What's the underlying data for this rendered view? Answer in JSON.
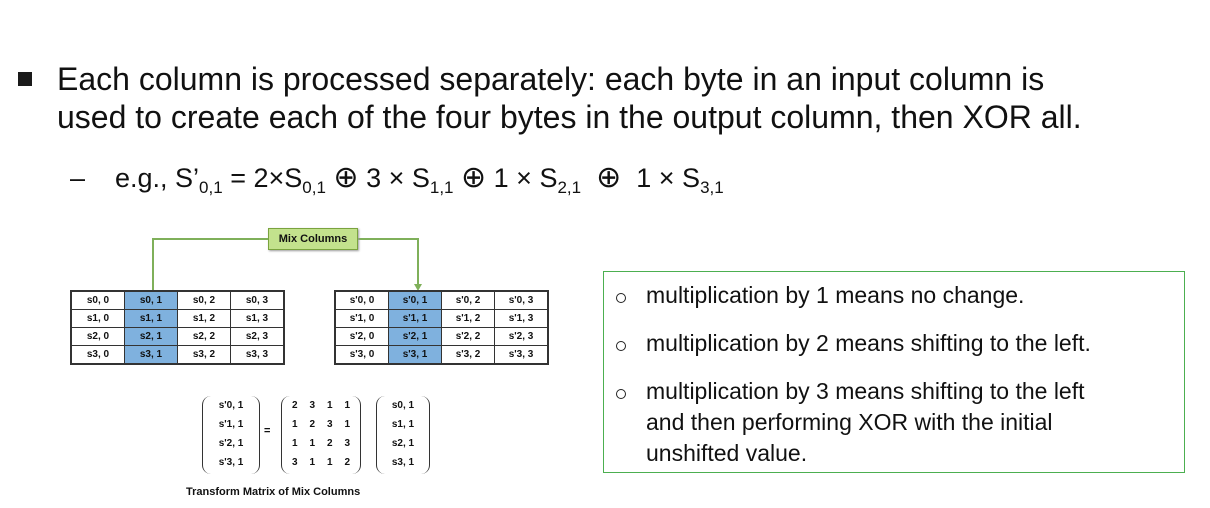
{
  "bullet_text": {
    "line1": "Each column is processed separately: each byte in an input column is",
    "line2": "used to create each of the four bytes in the output column, then XOR all."
  },
  "example": {
    "dash": "–",
    "prefix": "e.g., S’",
    "sub1": "0,1",
    "eq": " = 2×S",
    "sub2": "0,1",
    "xor": "⊕",
    "term2": " 3 × S",
    "sub3": "1,1",
    "term3": " 1 × S",
    "sub4": "2,1",
    "term4": " 1 × S",
    "sub5": "3,1"
  },
  "diagram": {
    "mix_columns_label": "Mix Columns",
    "input_grid": [
      [
        "s0, 0",
        "s0, 1",
        "s0, 2",
        "s0, 3"
      ],
      [
        "s1, 0",
        "s1, 1",
        "s1, 2",
        "s1, 3"
      ],
      [
        "s2, 0",
        "s2, 1",
        "s2, 2",
        "s2, 3"
      ],
      [
        "s3, 0",
        "s3, 1",
        "s3, 2",
        "s3, 3"
      ]
    ],
    "output_grid": [
      [
        "s'0, 0",
        "s'0, 1",
        "s'0, 2",
        "s'0, 3"
      ],
      [
        "s'1, 0",
        "s'1, 1",
        "s'1, 2",
        "s'1, 3"
      ],
      [
        "s'2, 0",
        "s'2, 1",
        "s'2, 2",
        "s'2, 3"
      ],
      [
        "s'3, 0",
        "s'3, 1",
        "s'3, 2",
        "s'3, 3"
      ]
    ],
    "highlight_column": 1,
    "output_vector": [
      "s'0, 1",
      "s'1, 1",
      "s'2, 1",
      "s'3, 1"
    ],
    "equals": "=",
    "matrix": [
      [
        "2",
        "3",
        "1",
        "1"
      ],
      [
        "1",
        "2",
        "3",
        "1"
      ],
      [
        "1",
        "1",
        "2",
        "3"
      ],
      [
        "3",
        "1",
        "1",
        "2"
      ]
    ],
    "input_vector": [
      "s0, 1",
      "s1, 1",
      "s2, 1",
      "s3, 1"
    ],
    "caption": "Transform Matrix of Mix Columns",
    "colors": {
      "highlight": "#7fb1de",
      "label_fill": "#c3e28d",
      "connector": "#7fb05a"
    }
  },
  "notes": {
    "border_color": "#4caf50",
    "item1": "multiplication by 1 means no change.",
    "item2": "multiplication by 2 means shifting to the left.",
    "item3_line1": "multiplication by 3 means shifting to the left",
    "item3_line2": "and then performing XOR with the initial",
    "item3_line3": "unshifted value."
  }
}
